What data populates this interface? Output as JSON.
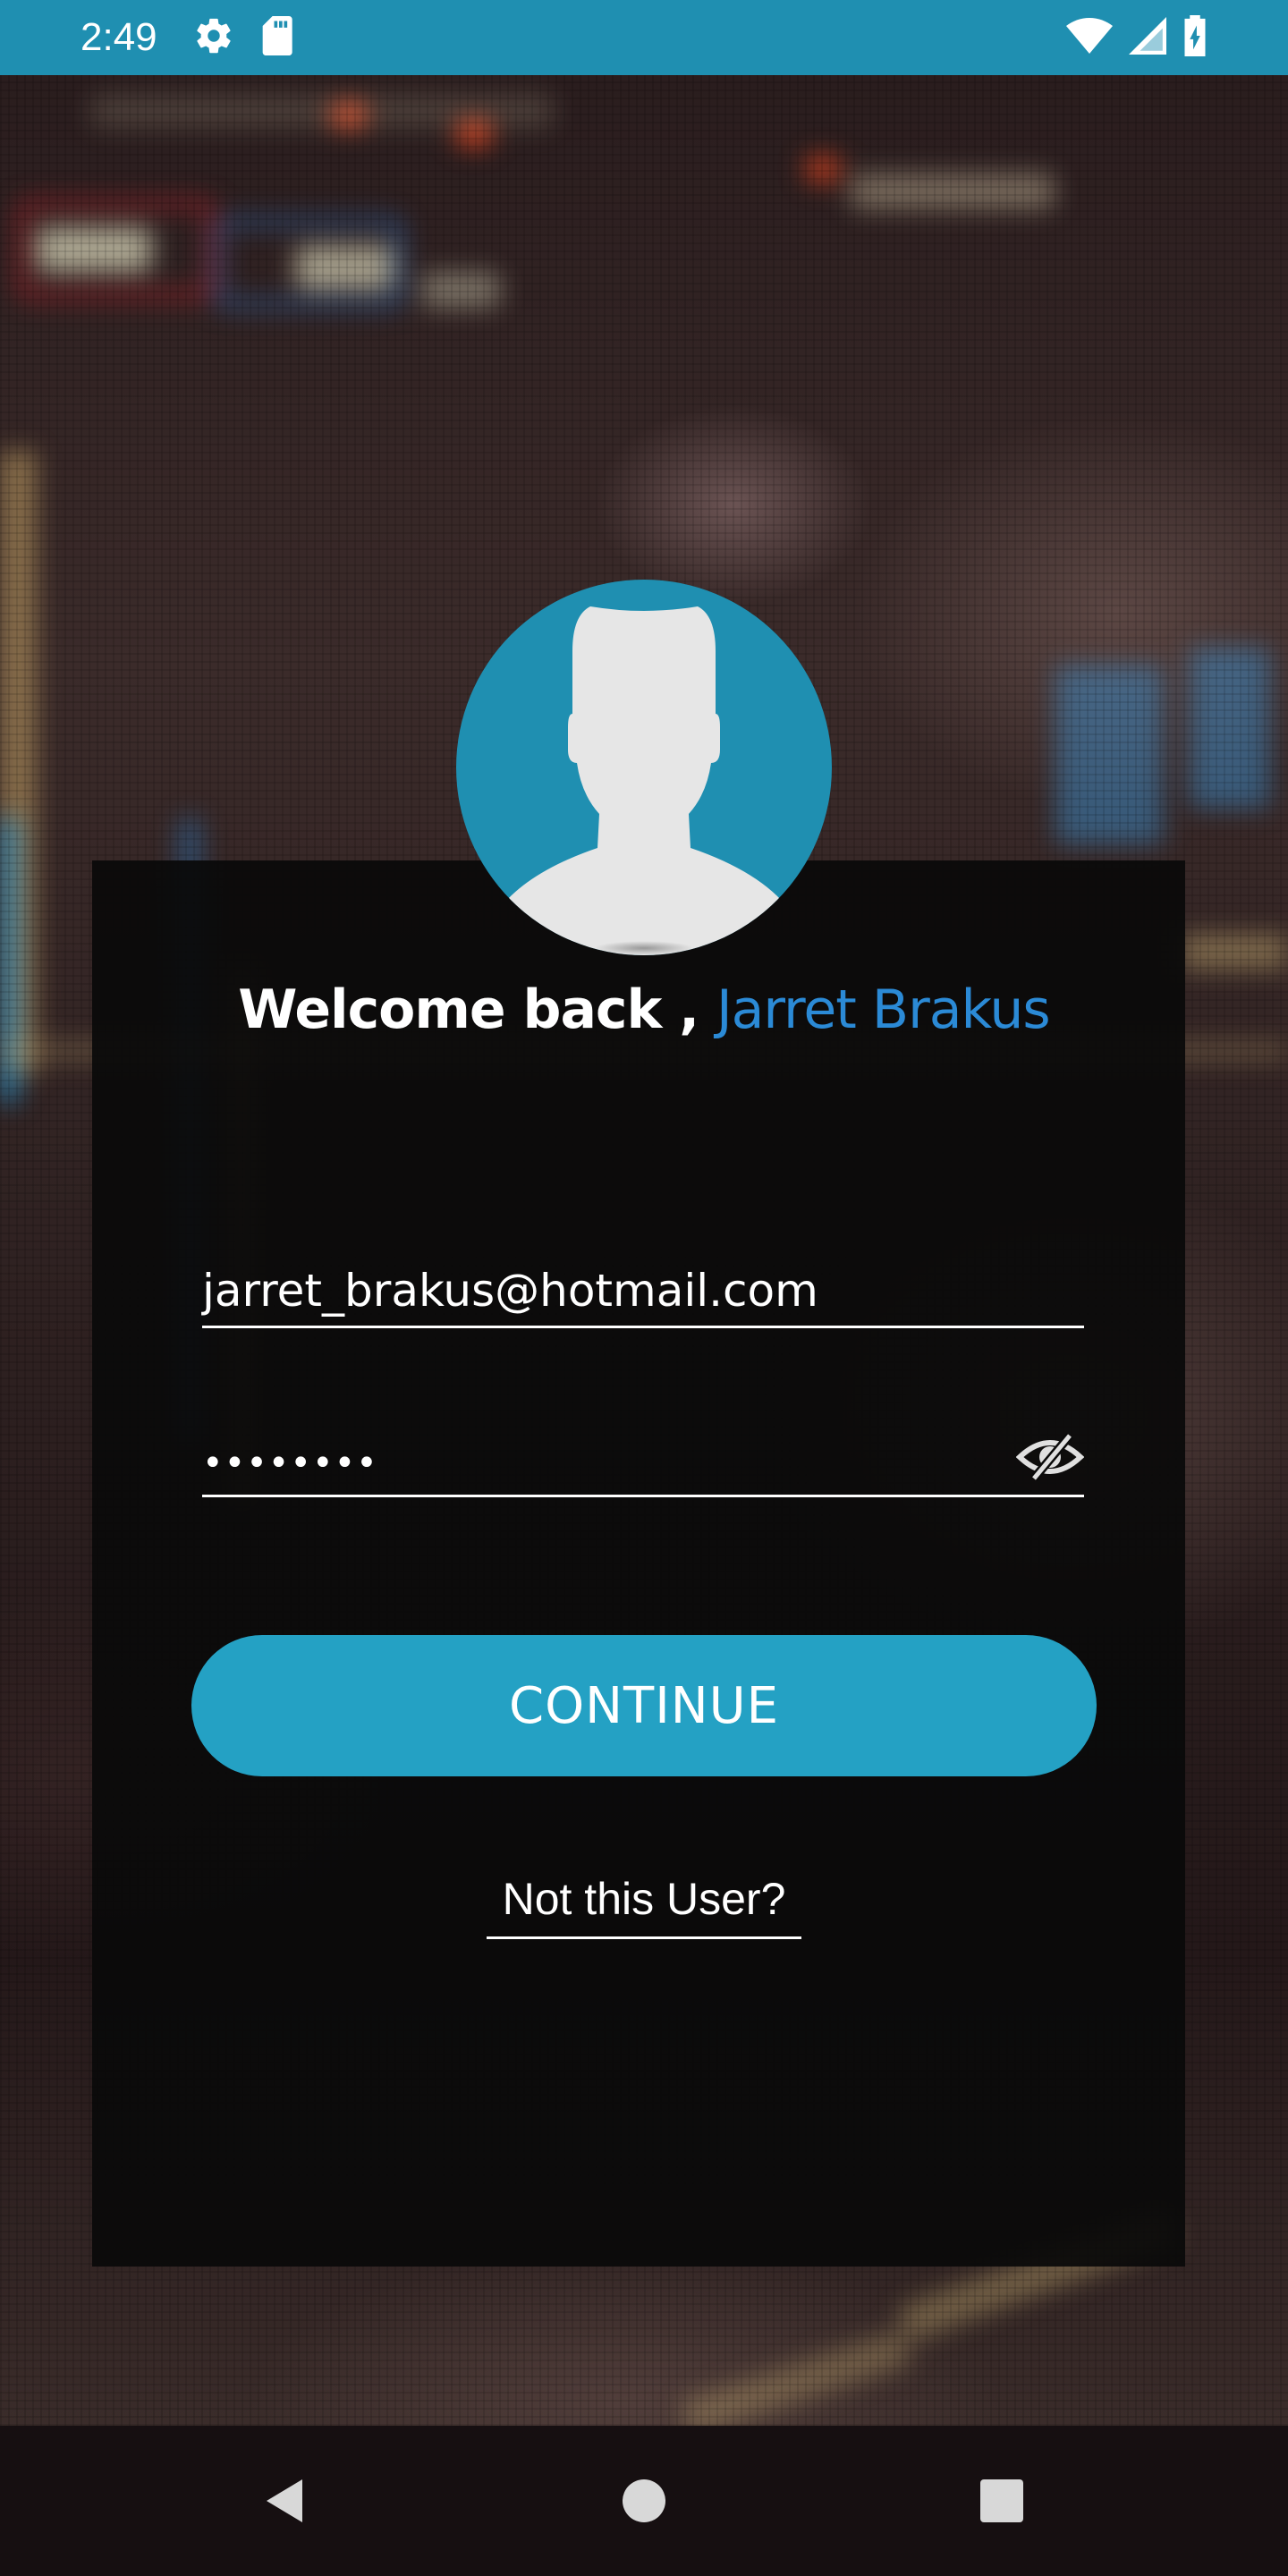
{
  "status_bar": {
    "time": "2:49",
    "left_icons": [
      "settings-icon",
      "sd-card-icon"
    ],
    "right_icons": [
      "wifi-icon",
      "cell-signal-icon",
      "battery-charging-icon"
    ],
    "background_color": "#1f8fb1"
  },
  "login": {
    "welcome_prefix": "Welcome back , ",
    "user_name": "Jarret Brakus",
    "email_value": "jarret_brakus@hotmail.com",
    "password_masked": "••••••••",
    "password_visibility_icon": "eye-off-icon",
    "continue_label": "CONTINUE",
    "not_user_label": "Not this User?",
    "accent_color": "#24a1c4",
    "name_color": "#2b8ad6"
  },
  "nav_bar": {
    "buttons": [
      "back-icon",
      "home-icon",
      "recents-icon"
    ]
  }
}
